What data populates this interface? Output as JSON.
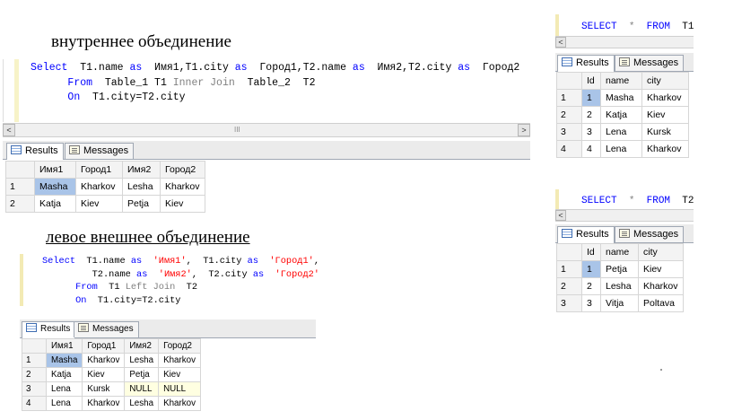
{
  "headings": {
    "inner_join": "внутреннее объединение",
    "left_join": "левое внешнее объединение"
  },
  "query1": {
    "lines": [
      [
        [
          "kw",
          "Select"
        ],
        [
          "",
          "  T1.name "
        ],
        [
          "kw",
          "as"
        ],
        [
          "",
          "  Имя1,T1.city "
        ],
        [
          "kw",
          "as"
        ],
        [
          "",
          "  Город1,T2.name "
        ],
        [
          "kw",
          "as"
        ],
        [
          "",
          "  Имя2,T2.city "
        ],
        [
          "kw",
          "as"
        ],
        [
          "",
          "  Город2"
        ]
      ],
      [
        [
          "",
          "      "
        ],
        [
          "kw",
          "From"
        ],
        [
          "",
          "  Table_1 T1 "
        ],
        [
          "gr",
          "Inner Join"
        ],
        [
          "",
          "  Table_2  T2"
        ]
      ],
      [
        [
          "",
          "      "
        ],
        [
          "kw",
          "On"
        ],
        [
          "",
          "  T1.city=T2.city"
        ]
      ]
    ]
  },
  "query2": {
    "lines": [
      [
        [
          "kw",
          "Select"
        ],
        [
          "",
          "  T1.name "
        ],
        [
          "kw",
          "as"
        ],
        [
          "",
          "  "
        ],
        [
          "str",
          "'Имя1'"
        ],
        [
          "",
          ",  T1.city "
        ],
        [
          "kw",
          "as"
        ],
        [
          "",
          "  "
        ],
        [
          "str",
          "'Город1'"
        ],
        [
          "",
          ","
        ]
      ],
      [
        [
          "",
          "         T2.name "
        ],
        [
          "kw",
          "as"
        ],
        [
          "",
          "  "
        ],
        [
          "str",
          "'Имя2'"
        ],
        [
          "",
          ",  T2.city "
        ],
        [
          "kw",
          "as"
        ],
        [
          "",
          "  "
        ],
        [
          "str",
          "'Город2'"
        ]
      ],
      [
        [
          "",
          "      "
        ],
        [
          "kw",
          "From"
        ],
        [
          "",
          "  T1 "
        ],
        [
          "gr",
          "Left Join"
        ],
        [
          "",
          "  T2"
        ]
      ],
      [
        [
          "",
          "      "
        ],
        [
          "kw",
          "On"
        ],
        [
          "",
          "  T1.city=T2.city"
        ]
      ]
    ]
  },
  "query3": {
    "lines": [
      [
        [
          "kw",
          "SELECT"
        ],
        [
          "",
          "  "
        ],
        [
          "gr",
          "*"
        ],
        [
          "",
          "  "
        ],
        [
          "kw",
          "FROM"
        ],
        [
          "",
          "  T1"
        ]
      ]
    ]
  },
  "query4": {
    "lines": [
      [
        [
          "kw",
          "SELECT"
        ],
        [
          "",
          "  "
        ],
        [
          "gr",
          "*"
        ],
        [
          "",
          "  "
        ],
        [
          "kw",
          "FROM"
        ],
        [
          "",
          "  T2"
        ]
      ]
    ]
  },
  "tabs": {
    "results": "Results",
    "messages": "Messages"
  },
  "scroll": {
    "left_arrow": "<",
    "right_arrow": ">",
    "grip": "III"
  },
  "grid_inner": {
    "columns": [
      "Имя1",
      "Город1",
      "Имя2",
      "Город2"
    ],
    "rows": [
      {
        "n": "1",
        "cells": [
          "Masha",
          "Kharkov",
          "Lesha",
          "Kharkov"
        ]
      },
      {
        "n": "2",
        "cells": [
          "Katja",
          "Kiev",
          "Petja",
          "Kiev"
        ]
      }
    ]
  },
  "grid_left": {
    "columns": [
      "Имя1",
      "Город1",
      "Имя2",
      "Город2"
    ],
    "rows": [
      {
        "n": "1",
        "cells": [
          "Masha",
          "Kharkov",
          "Lesha",
          "Kharkov"
        ]
      },
      {
        "n": "2",
        "cells": [
          "Katja",
          "Kiev",
          "Petja",
          "Kiev"
        ]
      },
      {
        "n": "3",
        "cells": [
          "Lena",
          "Kursk",
          "NULL",
          "NULL"
        ]
      },
      {
        "n": "4",
        "cells": [
          "Lena",
          "Kharkov",
          "Lesha",
          "Kharkov"
        ]
      }
    ]
  },
  "grid_t1": {
    "columns": [
      "Id",
      "name",
      "city"
    ],
    "rows": [
      {
        "n": "1",
        "cells": [
          "1",
          "Masha",
          "Kharkov"
        ]
      },
      {
        "n": "2",
        "cells": [
          "2",
          "Katja",
          "Kiev"
        ]
      },
      {
        "n": "3",
        "cells": [
          "3",
          "Lena",
          "Kursk"
        ]
      },
      {
        "n": "4",
        "cells": [
          "4",
          "Lena",
          "Kharkov"
        ]
      }
    ]
  },
  "grid_t2": {
    "columns": [
      "Id",
      "name",
      "city"
    ],
    "rows": [
      {
        "n": "1",
        "cells": [
          "1",
          "Petja",
          "Kiev"
        ]
      },
      {
        "n": "2",
        "cells": [
          "2",
          "Lesha",
          "Kharkov"
        ]
      },
      {
        "n": "3",
        "cells": [
          "3",
          "Vitja",
          "Poltava"
        ]
      }
    ]
  },
  "colors": {
    "keyword": "#0000ff",
    "gray_keyword": "#808080",
    "string": "#ff0000",
    "selected_cell": "#a9c4e8",
    "null_cell": "#ffffe1"
  }
}
